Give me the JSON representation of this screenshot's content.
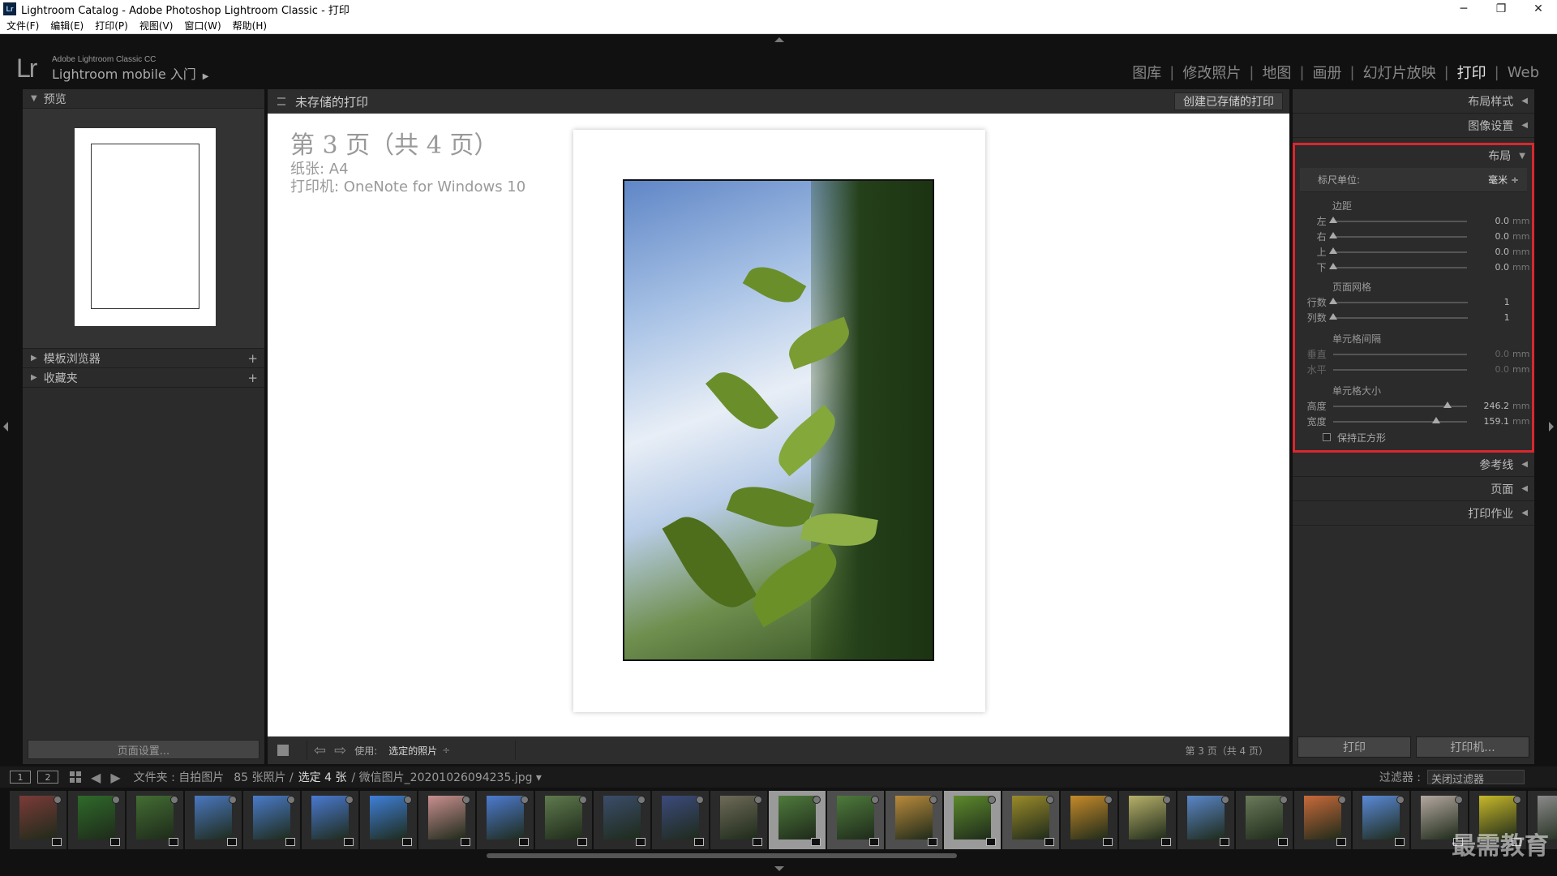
{
  "window": {
    "title": "Lightroom Catalog - Adobe Photoshop Lightroom Classic - 打印",
    "app_icon": "Lr"
  },
  "menu": [
    "文件(F)",
    "编辑(E)",
    "打印(P)",
    "视图(V)",
    "窗口(W)",
    "帮助(H)"
  ],
  "identity": {
    "logo": "Lr",
    "product": "Adobe Lightroom Classic CC",
    "mobile": "Lightroom mobile 入门",
    "arrow": "▶"
  },
  "modules": [
    "图库",
    "修改照片",
    "地图",
    "画册",
    "幻灯片放映",
    "打印",
    "Web"
  ],
  "active_module": "打印",
  "left_panel": {
    "preview": "预览",
    "template_browser": "模板浏览器",
    "collections": "收藏夹",
    "page_setup": "页面设置..."
  },
  "center": {
    "header": "未存储的打印",
    "save_button": "创建已存储的打印",
    "page_info": "第 3 页（共 4 页）",
    "paper": "纸张: A4",
    "printer": "打印机: OneNote for Windows 10",
    "use_label": "使用:",
    "use_value": "选定的照片",
    "page_status": "第 3 页（共 4 页）"
  },
  "right_panel": {
    "layout_style": "布局样式",
    "image_settings": "图像设置",
    "layout": "布局",
    "ruler_units_label": "标尺单位:",
    "ruler_units_value": "毫米 ÷",
    "margins_title": "边距",
    "margins": [
      {
        "label": "左",
        "value": "0.0",
        "unit": "mm",
        "pos": 0
      },
      {
        "label": "右",
        "value": "0.0",
        "unit": "mm",
        "pos": 0
      },
      {
        "label": "上",
        "value": "0.0",
        "unit": "mm",
        "pos": 0
      },
      {
        "label": "下",
        "value": "0.0",
        "unit": "mm",
        "pos": 0
      }
    ],
    "grid_title": "页面网格",
    "grid": [
      {
        "label": "行数",
        "value": "1",
        "unit": "",
        "pos": 0
      },
      {
        "label": "列数",
        "value": "1",
        "unit": "",
        "pos": 0
      }
    ],
    "spacing_title": "单元格间隔",
    "spacing": [
      {
        "label": "垂直",
        "value": "0.0",
        "unit": "mm",
        "pos": 0
      },
      {
        "label": "水平",
        "value": "0.0",
        "unit": "mm",
        "pos": 0
      }
    ],
    "cellsize_title": "单元格大小",
    "cellsize": [
      {
        "label": "高度",
        "value": "246.2",
        "unit": "mm",
        "pos": 0.82
      },
      {
        "label": "宽度",
        "value": "159.1",
        "unit": "mm",
        "pos": 0.74
      }
    ],
    "keep_square": "保持正方形",
    "guides": "参考线",
    "page": "页面",
    "print_job": "打印作业",
    "print_button": "打印",
    "printer_button": "打印机..."
  },
  "filmstrip_bar": {
    "view1": "1",
    "view2": "2",
    "folder": "文件夹 : 自拍图片",
    "count": "85 张照片 /",
    "selected": "选定 4 张",
    "file": "/ 微信图片_20201026094235.jpg ▾",
    "filter_label": "过滤器 :",
    "filter_value": "关闭过滤器"
  },
  "watermark": "最需教育",
  "colors": {
    "accent_highlight": "#d9272e",
    "panel": "#2b2b2b",
    "background": "#111111"
  }
}
